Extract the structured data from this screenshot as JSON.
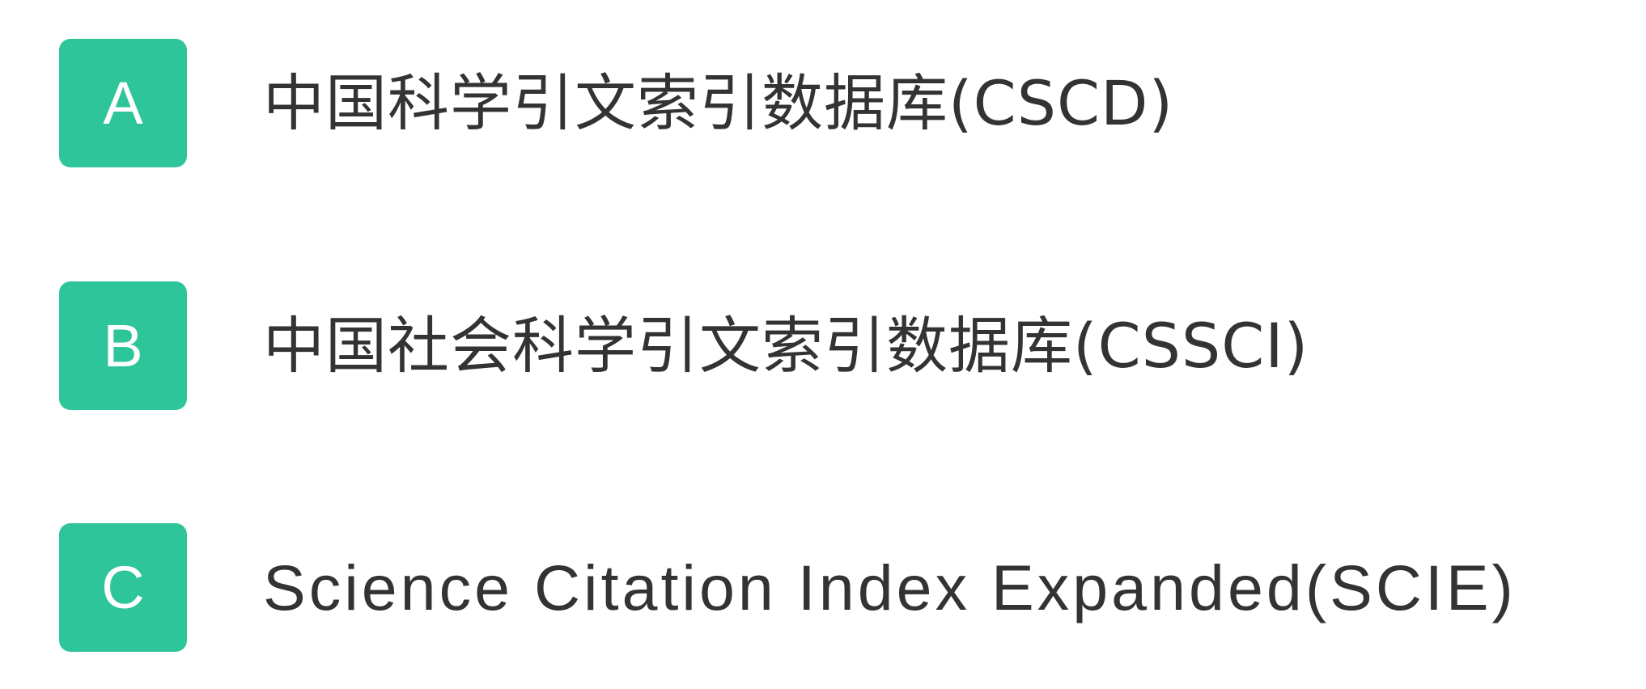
{
  "accent_color": "#2fc59b",
  "text_color": "#333333",
  "options": [
    {
      "letter": "A",
      "text": "中国科学引文索引数据库(CSCD)"
    },
    {
      "letter": "B",
      "text": "中国社会科学引文索引数据库(CSSCI)"
    },
    {
      "letter": "C",
      "text": "Science Citation Index Expanded(SCIE)"
    }
  ]
}
